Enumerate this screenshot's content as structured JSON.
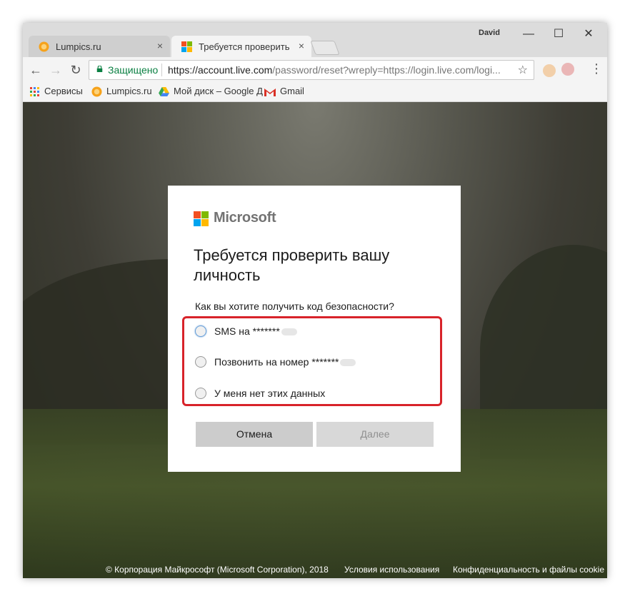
{
  "window": {
    "profile_name": "David",
    "minimize_glyph": "—",
    "maximize_glyph": "☐",
    "close_glyph": "✕"
  },
  "tabs": [
    {
      "title": "Lumpics.ru",
      "close": "×",
      "icon": "lumpics-orange-icon"
    },
    {
      "title": "Требуется проверить ва",
      "close": "×",
      "icon": "microsoft-icon"
    }
  ],
  "toolbar": {
    "back_glyph": "←",
    "forward_glyph": "→",
    "reload_glyph": "↻",
    "secure_label": "Защищено",
    "url_host": "https://account.live.com",
    "url_rest": "/password/reset?wreply=https://login.live.com/logi...",
    "star_glyph": "☆",
    "menu_glyph": "⋮"
  },
  "bookmarks": [
    {
      "label": "Сервисы",
      "icon": "apps-grid-icon"
    },
    {
      "label": "Lumpics.ru",
      "icon": "lumpics-orange-icon"
    },
    {
      "label": "Мой диск – Google Д",
      "icon": "google-drive-icon"
    },
    {
      "label": "Gmail",
      "icon": "gmail-icon"
    }
  ],
  "dialog": {
    "brand": "Microsoft",
    "title": "Требуется проверить вашу личность",
    "question": "Как вы хотите получить код безопасности?",
    "options": [
      {
        "label": "SMS на *******"
      },
      {
        "label": "Позвонить на номер *******"
      },
      {
        "label": "У меня нет этих данных"
      }
    ],
    "cancel_label": "Отмена",
    "next_label": "Далее"
  },
  "footer": {
    "copyright": "© Корпорация Майкрософт (Microsoft Corporation), 2018",
    "terms": "Условия использования",
    "privacy": "Конфиденциальность и файлы cookie"
  },
  "colors": {
    "highlight": "#d8232a",
    "secure_green": "#0b8043",
    "ms_red": "#f25022",
    "ms_green": "#7fba00",
    "ms_blue": "#00a4ef",
    "ms_yellow": "#ffb900"
  }
}
